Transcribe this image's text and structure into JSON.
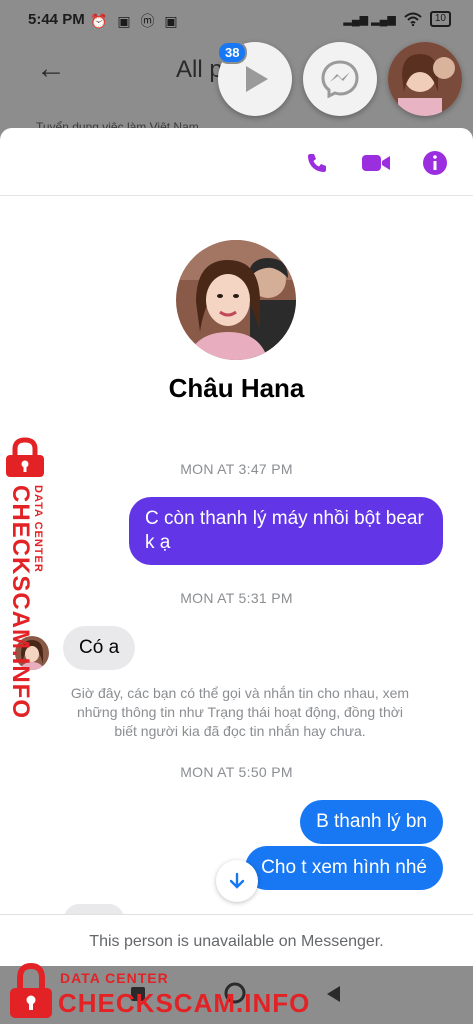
{
  "status_bar": {
    "time": "5:44 PM",
    "notification_icons": "⏰ ▣ ⓜ ▣",
    "signal": "▂▄▆ ▂▄▆",
    "wifi": "wifi",
    "battery": "10"
  },
  "background_app": {
    "back_arrow": "←",
    "title": "All p",
    "subtitle": "Tuyển dụng việc làm Việt Nam"
  },
  "chat_heads": {
    "badge_count": "38",
    "icons": [
      "play-icon",
      "messenger-icon",
      "avatar"
    ]
  },
  "toolbar": {
    "icons": [
      "phone-icon",
      "video-icon",
      "info-icon"
    ],
    "accent_color": "#9b2fe0"
  },
  "profile": {
    "name": "Châu Hana"
  },
  "messages": {
    "time_1": "MON AT 3:47 PM",
    "msg_1": "C còn thanh lý máy nhồi bột bear k ạ",
    "time_2": "MON AT 5:31 PM",
    "msg_2": "Có a",
    "system_note": "Giờ đây, các bạn có thể gọi và nhắn tin cho nhau, xem những thông tin như Trạng thái hoạt động, đồng thời biết người kia đã đọc tin nhắn hay chưa.",
    "time_3": "MON AT 5:50 PM",
    "msg_3": "B thanh lý bn",
    "msg_4": "Cho t xem hình nhé"
  },
  "footer": {
    "unavailable_text": "This person is unavailable on Messenger."
  },
  "nav": {
    "buttons": [
      "recents-square",
      "home-circle",
      "back-triangle"
    ]
  },
  "watermark": {
    "small": "DATA CENTER",
    "big": "CHECKSCAM.INFO"
  },
  "colors": {
    "purple_bubble": "#6235e6",
    "blue_bubble": "#1877f2",
    "incoming_bubble": "#e9e9eb",
    "watermark_red": "#e32226"
  }
}
